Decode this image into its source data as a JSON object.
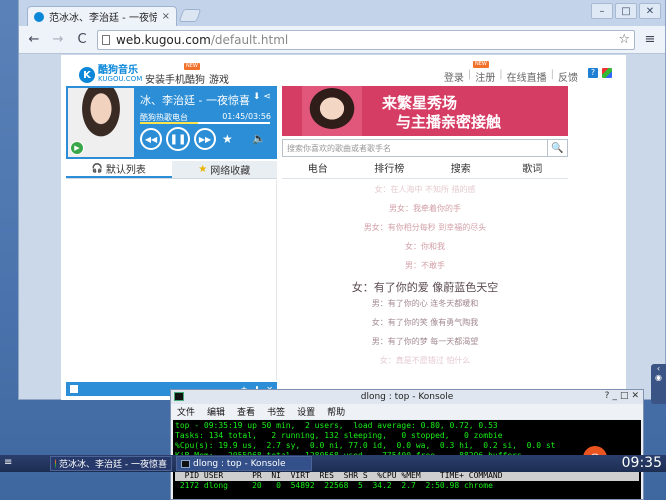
{
  "browser": {
    "tab_title": "范冰冰、李治廷 - 一夜惊喜",
    "tab_close": "×",
    "win_min": "–",
    "win_max": "□",
    "win_close": "✕",
    "back": "←",
    "forward": "→",
    "reload": "C",
    "url_host": "web.kugou.com",
    "url_path": "/default.html",
    "bookmark_star": "☆",
    "menu": "≡"
  },
  "kugou": {
    "logo_mark": "K",
    "logo_cn": "酷狗音乐",
    "logo_en": "KUGOU.COM",
    "nav_mobile": "安装手机酷狗",
    "nav_games": "游戏",
    "nav_new_badge": "NEW",
    "login": "登录",
    "register": "注册",
    "live": "在线直播",
    "feedback": "反馈",
    "separator": "|",
    "help": "?"
  },
  "player": {
    "song_title": "冰、李治廷 - 一夜惊喜",
    "station": "酷狗热歌电台",
    "time": "01:45/03:56",
    "progress_fraction": 0.445,
    "download_icon": "⬇",
    "share_icon": "⋖",
    "prev": "◀◀",
    "pause": "❚❚",
    "next": "▶▶",
    "fav": "★",
    "volume": "🔈",
    "cover_play": "▶"
  },
  "banner": {
    "line1": "来繁星秀场",
    "line2": "与主播亲密接触"
  },
  "search": {
    "placeholder": "搜索你喜欢的歌曲或者歌手名",
    "icon": "🔍"
  },
  "tabs": {
    "default_list": "默认列表",
    "net_favorites": "网络收藏",
    "radio": "电台",
    "charts": "排行榜",
    "search": "搜索",
    "lyrics": "歌词"
  },
  "list_footer": {
    "fav": "★",
    "download": "⬇",
    "delete": "✕"
  },
  "lyrics": [
    {
      "text": "女：在人海中  不知所  措的感",
      "cls": "dim"
    },
    {
      "text": "男女：我牵着你的手",
      "cls": ""
    },
    {
      "text": "男女：有你相分每秒  到幸福的尽头",
      "cls": ""
    },
    {
      "text": "女：你和我",
      "cls": ""
    },
    {
      "text": "男：不敢手",
      "cls": ""
    },
    {
      "text": "女：有了你的爱  像蔚蓝色天空",
      "cls": "current"
    },
    {
      "text": "男：有了你的心  连冬天都暖和",
      "cls": "near"
    },
    {
      "text": "女：有了你的笑  像有勇气陶我",
      "cls": "near"
    },
    {
      "text": "男：有了你的梦  每一天都渴望",
      "cls": "near"
    },
    {
      "text": "女：真是不愿错过  怕什么",
      "cls": "dim"
    }
  ],
  "konsole": {
    "title": "dlong : top - Konsole",
    "btn_help": "?",
    "btn_min": "_",
    "btn_max": "□",
    "btn_close": "✕",
    "menu": [
      "文件",
      "编辑",
      "查看",
      "书签",
      "设置",
      "帮助"
    ],
    "lines": [
      "top - 09:35:19 up 50 min,  2 users,  load average: 0.80, 0.72, 0.53",
      "Tasks: 134 total,   2 running, 132 sleeping,   0 stopped,   0 zombie",
      "%Cpu(s): 19.9 us,  2.7 sy,  0.0 ni, 77.0 id,  0.0 wa,  0.3 hi,  0.2 si,  0.0 st",
      "KiB Mem:   2055968 total,  1280568 used,   775400 free,    88296 buffers",
      "KiB Swap:  2113532 total,        0 used,  2113532 free,   703664 cached"
    ],
    "header": "  PID USER      PR  NI  VIRT  RES  SHR S  %CPU %MEM    TIME+ COMMAND",
    "row": " 2172 dlong     20   0  54892  22568  5  34.2  2.7  2:50.98 chrome"
  },
  "taskbar": {
    "start": "≡",
    "task_browser": "范冰冰、李治廷 - 一夜惊喜",
    "task_konsole": "dlong : top - Konsole",
    "clock": "09:35",
    "ubuntu": "◎"
  }
}
